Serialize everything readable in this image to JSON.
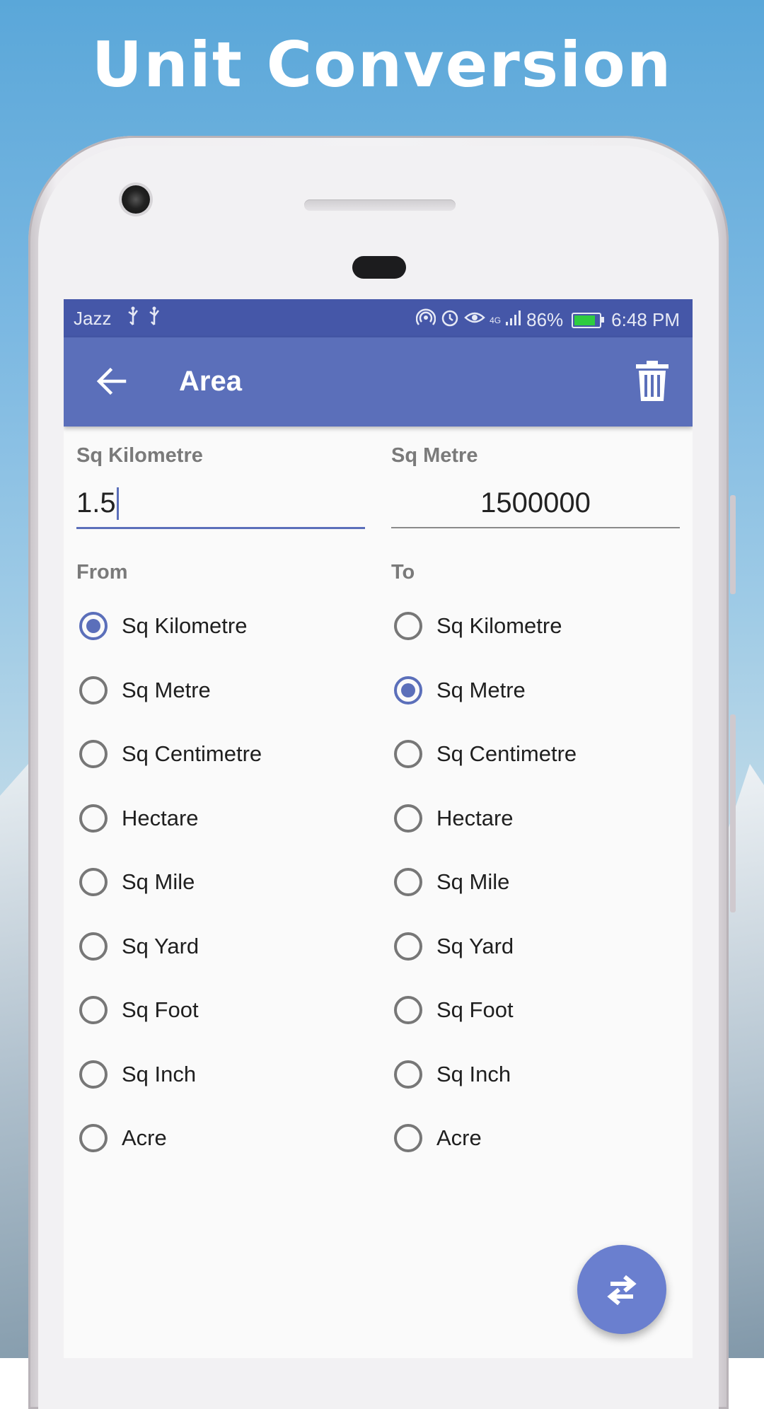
{
  "promo": {
    "headline": "Unit Conversion"
  },
  "statusbar": {
    "carrier": "Jazz",
    "usb_glyph": "⚡",
    "network": "4G",
    "battery": "86%",
    "battery_level": 0.86,
    "time": "6:48 PM"
  },
  "appbar": {
    "title": "Area"
  },
  "from_field": {
    "label": "Sq Kilometre",
    "value": "1.5"
  },
  "to_field": {
    "label": "Sq Metre",
    "value": "1500000"
  },
  "from_section": {
    "label": "From",
    "selected": "Sq Kilometre"
  },
  "to_section": {
    "label": "To",
    "selected": "Sq Metre"
  },
  "units": [
    "Sq Kilometre",
    "Sq Metre",
    "Sq Centimetre",
    "Hectare",
    "Sq Mile",
    "Sq Yard",
    "Sq Foot",
    "Sq Inch",
    "Acre"
  ],
  "colors": {
    "primary": "#5b6fba",
    "status_bar": "#4557a8",
    "fab": "#6a7fcf"
  }
}
